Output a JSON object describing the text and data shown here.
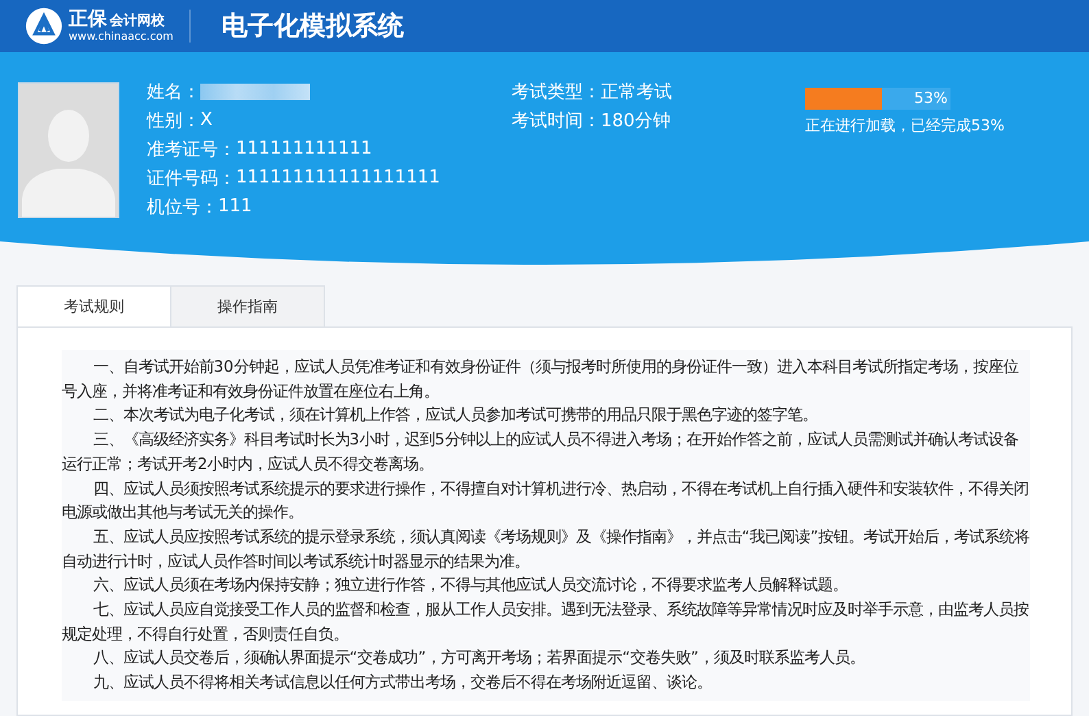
{
  "header": {
    "brand": "正保",
    "brand_sub": "会计网校",
    "url": "www.chinaacc.com",
    "title": "电子化模拟系统"
  },
  "candidate": {
    "fields": [
      {
        "label": "姓名：",
        "kind": "redacted"
      },
      {
        "label": "性别：",
        "value": "X",
        "kind": "text"
      },
      {
        "label": "准考证号：",
        "value": "111111111111",
        "kind": "text"
      },
      {
        "label": "证件号码：",
        "value": "111111111111111111",
        "kind": "text"
      },
      {
        "label": "机位号：",
        "value": "111",
        "kind": "text"
      }
    ]
  },
  "exam": {
    "fields": [
      {
        "label": "考试类型：",
        "value": "正常考试"
      },
      {
        "label": "考试时间：",
        "value": "180分钟"
      }
    ]
  },
  "progress": {
    "level": 0.53,
    "reading": "53%",
    "status": "正在进行加载，已经完成53%"
  },
  "tabs": [
    {
      "label": "考试规则",
      "selected": true
    },
    {
      "label": "操作指南",
      "selected": false
    }
  ],
  "rules": [
    "一、自考试开始前30分钟起，应试人员凭准考证和有效身份证件（须与报考时所使用的身份证件一致）进入本科目考试所指定考场，按座位号入座，并将准考证和有效身份证件放置在座位右上角。",
    "二、本次考试为电子化考试，须在计算机上作答，应试人员参加考试可携带的用品只限于黑色字迹的签字笔。",
    "三、《高级经济实务》科目考试时长为3小时，迟到5分钟以上的应试人员不得进入考场；在开始作答之前，应试人员需测试并确认考试设备运行正常；考试开考2小时内，应试人员不得交卷离场。",
    "四、应试人员须按照考试系统提示的要求进行操作，不得擅自对计算机进行冷、热启动，不得在考试机上自行插入硬件和安装软件，不得关闭电源或做出其他与考试无关的操作。",
    "五、应试人员应按照考试系统的提示登录系统，须认真阅读《考场规则》及《操作指南》，并点击“我已阅读”按钮。考试开始后，考试系统将自动进行计时，应试人员作答时间以考试系统计时器显示的结果为准。",
    "六、应试人员须在考场内保持安静；独立进行作答，不得与其他应试人员交流讨论，不得要求监考人员解释试题。",
    "七、应试人员应自觉接受工作人员的监督和检查，服从工作人员安排。遇到无法登录、系统故障等异常情况时应及时举手示意，由监考人员按规定处理，不得自行处置，否则责任自负。",
    "八、应试人员交卷后，须确认界面提示“交卷成功”，方可离开考场；若界面提示“交卷失败”，须及时联系监考人员。",
    "九、应试人员不得将相关考试信息以任何方式带出考场，交卷后不得在考场附近逗留、谈论。"
  ]
}
